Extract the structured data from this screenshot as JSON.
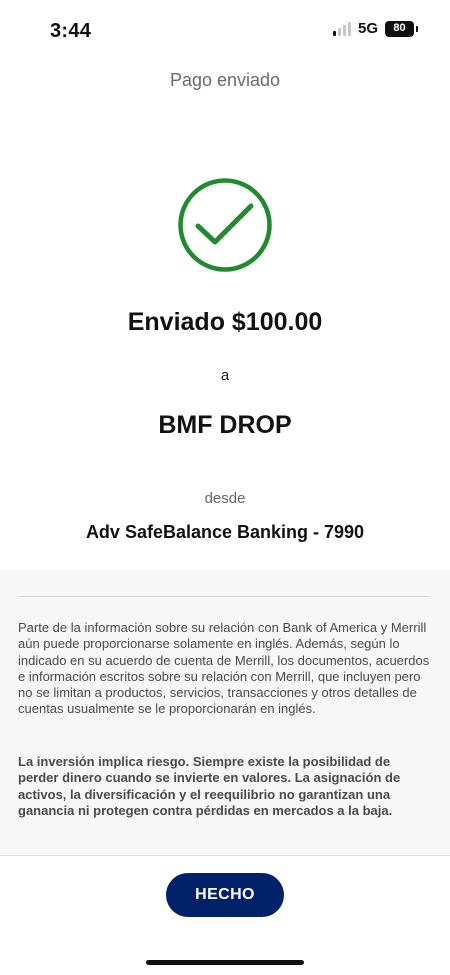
{
  "status_bar": {
    "time": "3:44",
    "network": "5G",
    "battery": "80",
    "signal_bars_active": 1,
    "signal_bars_total": 4
  },
  "header": {
    "title": "Pago enviado"
  },
  "icons": {
    "success": "check-circle-icon"
  },
  "confirmation": {
    "sent_amount": "Enviado $100.00",
    "to_label": "a",
    "recipient": "BMF DROP",
    "from_label": "desde",
    "account": "Adv SafeBalance Banking - 7990"
  },
  "disclosure": {
    "paragraph1": "Parte de la información sobre su relación con Bank of America y Merrill aún puede proporcionarse solamente en inglés. Además, según lo indicado en su acuerdo de cuenta de Merrill, los documentos, acuerdos e información escritos sobre su relación con Merrill, que incluyen pero no se limitan a productos, servicios, transacciones y otros detalles de cuentas usualmente se le proporcionarán en inglés.",
    "paragraph2": "La inversión implica riesgo. Siempre existe la posibilidad de perder dinero cuando se invierte en valores. La asignación de activos, la diversificación y el reequilibrio no garantizan una ganancia ni protegen contra pérdidas en mercados a la baja."
  },
  "footer": {
    "done_label": "HECHO"
  },
  "colors": {
    "success_green": "#1f8a2e",
    "button_navy": "#012169",
    "disclosure_bg": "#f7f7f7"
  }
}
